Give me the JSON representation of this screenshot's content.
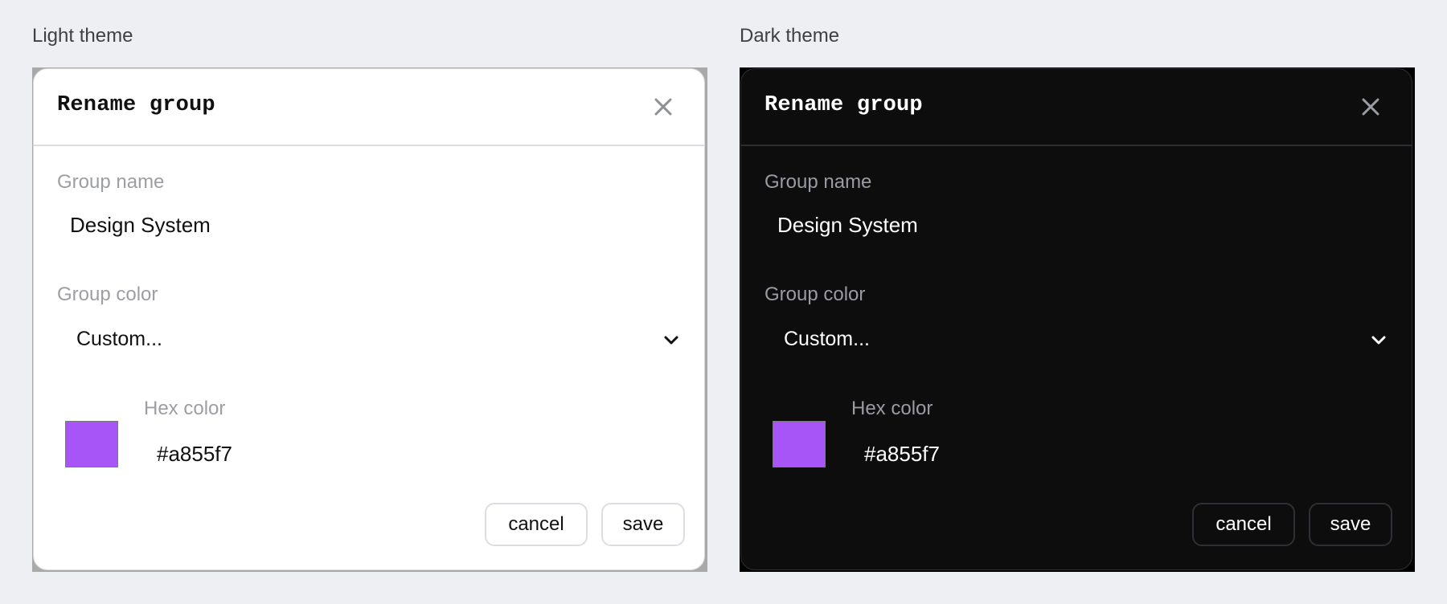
{
  "panels": [
    {
      "theme_label": "Light theme",
      "dialog": {
        "title": "Rename group",
        "group_name_label": "Group name",
        "group_name_value": "Design System",
        "group_color_label": "Group color",
        "group_color_selected": "Custom...",
        "hex_label": "Hex color",
        "hex_value": "#a855f7",
        "cancel_label": "cancel",
        "save_label": "save"
      }
    },
    {
      "theme_label": "Dark theme",
      "dialog": {
        "title": "Rename group",
        "group_name_label": "Group name",
        "group_name_value": "Design System",
        "group_color_label": "Group color",
        "group_color_selected": "Custom...",
        "hex_label": "Hex color",
        "hex_value": "#a855f7",
        "cancel_label": "cancel",
        "save_label": "save"
      }
    }
  ],
  "colors": {
    "swatch": "#a855f7",
    "page_background": "#eeeff3"
  }
}
